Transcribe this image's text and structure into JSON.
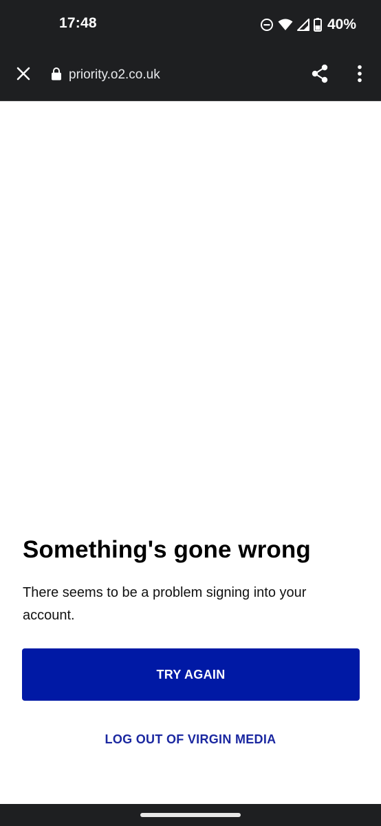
{
  "status_bar": {
    "time": "17:48",
    "battery_percent": "40%",
    "icons": [
      "do-not-disturb-icon",
      "wifi-icon",
      "signal-icon",
      "battery-icon"
    ]
  },
  "toolbar": {
    "url": "priority.o2.co.uk",
    "icons": [
      "close-icon",
      "lock-icon",
      "share-icon",
      "more-vert-icon"
    ]
  },
  "error": {
    "title": "Something's gone wrong",
    "description": "There seems to be a problem signing into your account."
  },
  "actions": {
    "try_again_label": "TRY AGAIN",
    "logout_label": "LOG OUT OF VIRGIN MEDIA"
  },
  "colors": {
    "primary_button": "#0019a5",
    "link": "#1a27a0",
    "system_bar": "#1e1f21"
  }
}
